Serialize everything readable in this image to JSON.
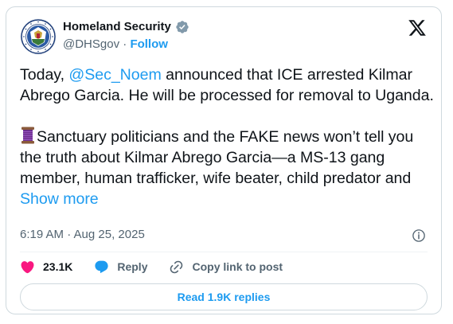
{
  "author": {
    "display_name": "Homeland Security",
    "handle": "@DHSgov",
    "separator": "·",
    "follow_label": "Follow",
    "verified_color": "#829aab"
  },
  "tweet": {
    "paragraph1": {
      "prefix": "Today, ",
      "mention": "@Sec_Noem",
      "suffix": " announced that ICE arrested Kilmar Abrego Garcia. He will be processed for removal to Uganda."
    },
    "paragraph2": {
      "text": "Sanctuary politicians and the FAKE news won’t tell you the truth about Kilmar Abrego Garcia—a MS-13 gang member, human trafficker, wife beater, child predator and ",
      "emoji_icon": "thread-spool-emoji",
      "show_more_label": "Show more"
    },
    "timestamp": "6:19 AM · Aug 25, 2025"
  },
  "actions": {
    "likes_count": "23.1K",
    "reply_label": "Reply",
    "copy_link_label": "Copy link to post"
  },
  "read_replies_label": "Read 1.9K replies",
  "colors": {
    "accent": "#1d9bf0",
    "like": "#f91880",
    "text": "#0f1419",
    "secondary": "#536471",
    "border": "#cfd9de"
  }
}
